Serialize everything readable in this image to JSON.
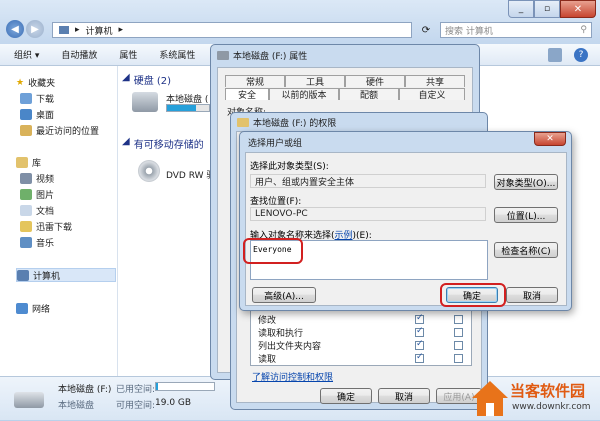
{
  "explorer": {
    "breadcrumb": [
      "计算机"
    ],
    "search_placeholder": "搜索 计算机",
    "toolbar": [
      "组织 ▾",
      "自动播放",
      "属性",
      "系统属性"
    ],
    "nav": {
      "favorites_title": "收藏夹",
      "favorites": [
        "下载",
        "桌面",
        "最近访问的位置"
      ],
      "libraries_title": "库",
      "libraries": [
        "视频",
        "图片",
        "文档",
        "迅雷下载",
        "音乐"
      ],
      "computer": "计算机",
      "network": "网络"
    },
    "groups": {
      "hdd_title": "硬盘 (2)",
      "hdd_item": "本地磁盘 (",
      "removable_title": "有可移动存储的",
      "dvd_item": "DVD RW 驱"
    },
    "status": {
      "name": "本地磁盘 (F:)",
      "used_label": "已用空间:",
      "free_label": "可用空间:",
      "free_value": "19.0 GB",
      "type_label": "本地磁盘"
    }
  },
  "properties": {
    "title": "本地磁盘 (F:) 属性",
    "tabs_row1": [
      "常规",
      "工具",
      "硬件",
      "共享"
    ],
    "tabs_row2": [
      "安全",
      "以前的版本",
      "配额",
      "自定义"
    ],
    "object_name_label": "对象名称:"
  },
  "permissions": {
    "title": "本地磁盘 (F:) 的权限",
    "rows": [
      {
        "name": "修改",
        "allow": true,
        "deny": false
      },
      {
        "name": "读取和执行",
        "allow": true,
        "deny": false
      },
      {
        "name": "列出文件夹内容",
        "allow": true,
        "deny": false
      },
      {
        "name": "读取",
        "allow": true,
        "deny": false
      }
    ],
    "link": "了解访问控制和权限",
    "ok": "确定",
    "cancel": "取消",
    "apply": "应用(A)"
  },
  "select_dialog": {
    "title": "选择用户或组",
    "type_label": "选择此对象类型(S):",
    "type_value": "用户、组或内置安全主体",
    "type_button": "对象类型(O)...",
    "location_label": "查找位置(F):",
    "location_value": "LENOVO-PC",
    "location_button": "位置(L)...",
    "names_label_pre": "输入对象名称来选择(",
    "names_label_link": "示例",
    "names_label_post": ")(E):",
    "names_value": "Everyone",
    "check_button": "检查名称(C)",
    "advanced_button": "高级(A)...",
    "ok": "确定",
    "cancel": "取消"
  },
  "watermark": {
    "brand": "当客软件园",
    "url": "www.downkr.com"
  }
}
